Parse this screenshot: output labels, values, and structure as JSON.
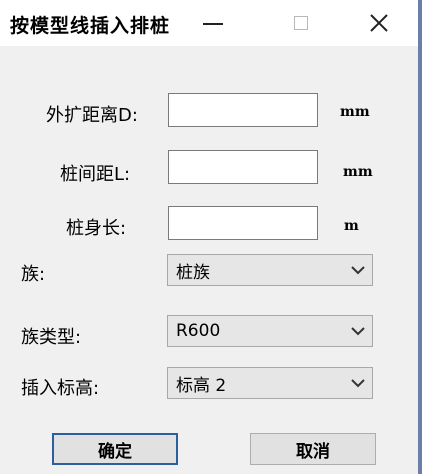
{
  "window": {
    "title": "按模型线插入排桩"
  },
  "form": {
    "offset_label": "外扩距离D:",
    "offset_value": "",
    "offset_unit": "mm",
    "spacing_label": "桩间距L:",
    "spacing_value": "",
    "spacing_unit": "mm",
    "length_label": "桩身长:",
    "length_value": "",
    "length_unit": "m",
    "family_label": "族:",
    "family_value": "桩族",
    "type_label": "族类型:",
    "type_value": "R600",
    "level_label": "插入标高:",
    "level_value": "标高 2"
  },
  "buttons": {
    "ok": "确定",
    "cancel": "取消"
  },
  "icons": {
    "minimize": "minimize-icon",
    "maximize": "maximize-icon",
    "close": "close-icon",
    "dropdown": "chevron-down-icon"
  }
}
